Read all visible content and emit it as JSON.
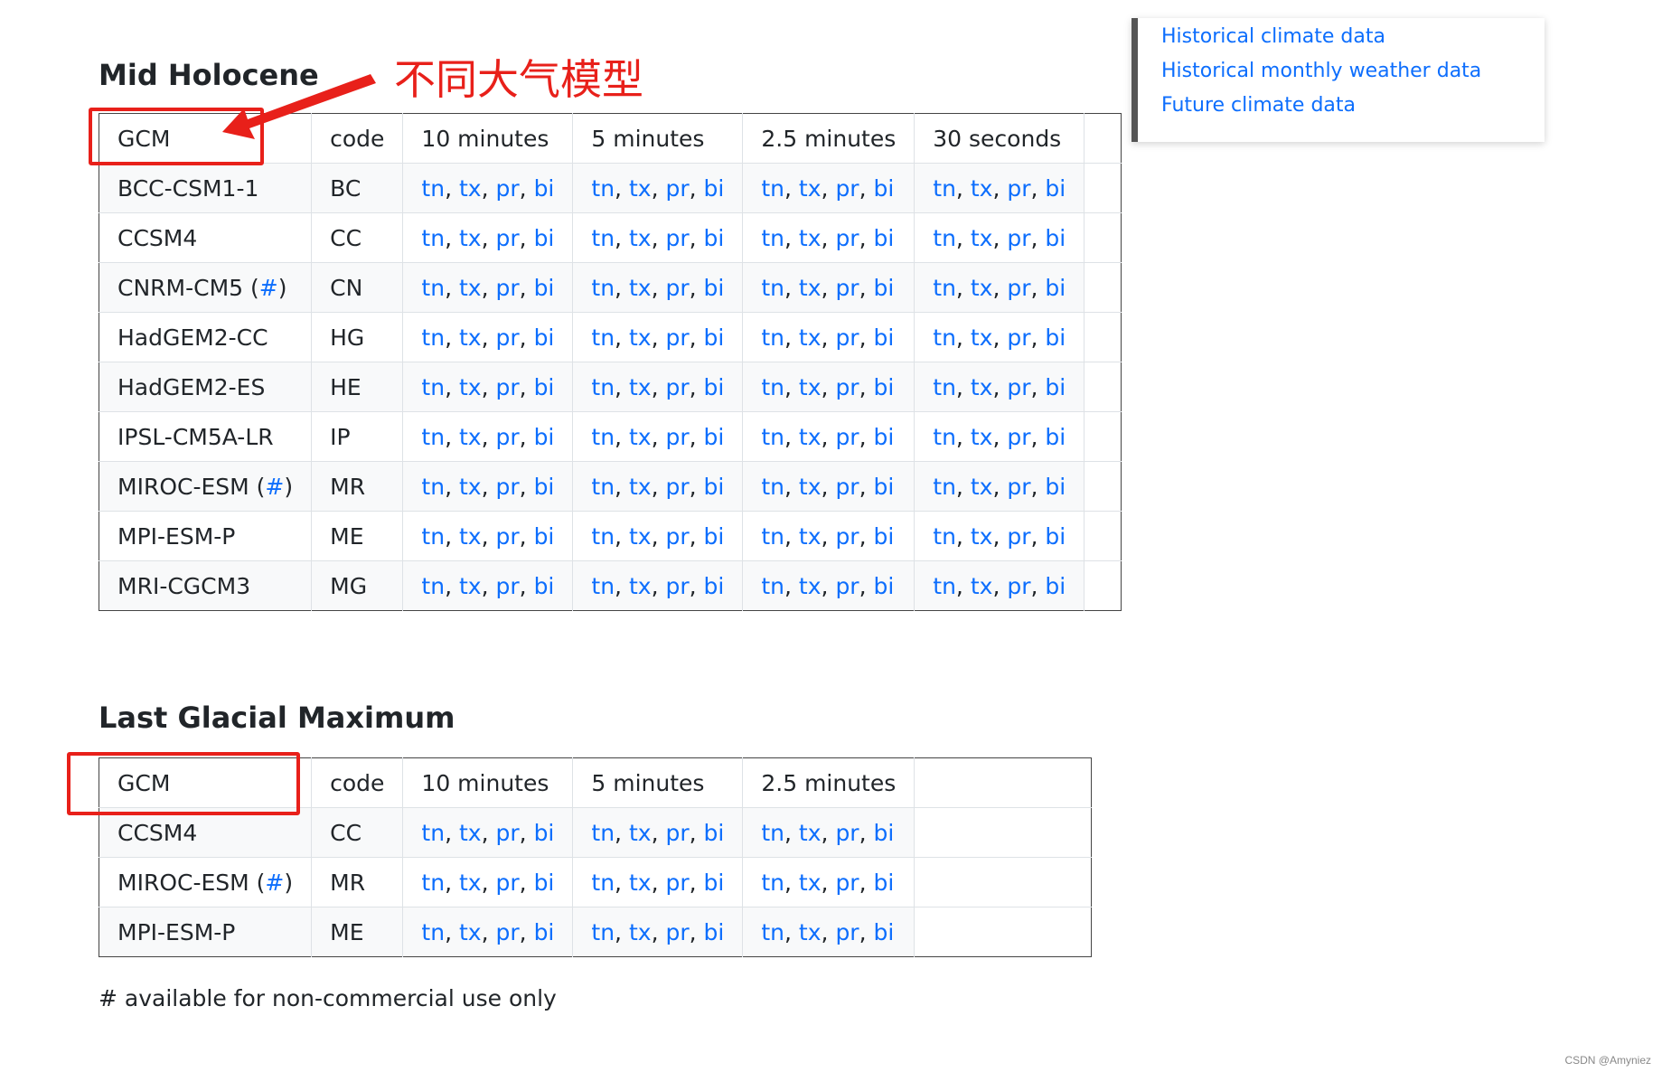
{
  "sidenav": {
    "links": [
      "Historical climate data",
      "Historical monthly weather data",
      "Future climate data"
    ]
  },
  "annotation": {
    "label": "不同大气模型",
    "color": "#e8201a"
  },
  "mid_holocene": {
    "title": "Mid Holocene",
    "headers": [
      "GCM",
      "code",
      "10 minutes",
      "5 minutes",
      "2.5 minutes",
      "30 seconds"
    ],
    "rows": [
      {
        "gcm": "BCC-CSM1-1",
        "hash": "",
        "code": "BC"
      },
      {
        "gcm": "CCSM4",
        "hash": "",
        "code": "CC"
      },
      {
        "gcm": "CNRM-CM5",
        "hash": "#",
        "code": "CN"
      },
      {
        "gcm": "HadGEM2-CC",
        "hash": "",
        "code": "HG"
      },
      {
        "gcm": "HadGEM2-ES",
        "hash": "",
        "code": "HE"
      },
      {
        "gcm": "IPSL-CM5A-LR",
        "hash": "",
        "code": "IP"
      },
      {
        "gcm": "MIROC-ESM",
        "hash": "#",
        "code": "MR"
      },
      {
        "gcm": "MPI-ESM-P",
        "hash": "",
        "code": "ME"
      },
      {
        "gcm": "MRI-CGCM3",
        "hash": "",
        "code": "MG"
      }
    ]
  },
  "last_glacial_maximum": {
    "title": "Last Glacial Maximum",
    "headers": [
      "GCM",
      "code",
      "10 minutes",
      "5 minutes",
      "2.5 minutes"
    ],
    "rows": [
      {
        "gcm": "CCSM4",
        "hash": "",
        "code": "CC"
      },
      {
        "gcm": "MIROC-ESM",
        "hash": "#",
        "code": "MR"
      },
      {
        "gcm": "MPI-ESM-P",
        "hash": "",
        "code": "ME"
      }
    ]
  },
  "variables": [
    "tn",
    "tx",
    "pr",
    "bi"
  ],
  "footnote": "# available for non-commercial use only",
  "watermark": "CSDN @Amyniez",
  "colors": {
    "link": "#0d6efd",
    "stripe": "#f8f9fa",
    "sidenav_border": "#555555"
  }
}
